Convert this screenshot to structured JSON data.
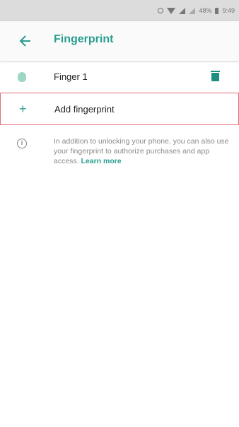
{
  "status_bar": {
    "battery_text": "48%",
    "time": "9:49",
    "icons": [
      "alarm-icon",
      "wifi-icon",
      "signal-icon",
      "signal-icon",
      "battery-icon"
    ]
  },
  "app_bar": {
    "title": "Fingerprint",
    "back_icon": "arrow-left-icon"
  },
  "fingerprints": [
    {
      "label": "Finger 1",
      "icon": "fingerprint-icon",
      "action_icon": "delete-icon"
    }
  ],
  "add": {
    "label": "Add fingerprint",
    "icon": "plus-icon"
  },
  "info": {
    "text": "In addition to unlocking your phone, you can also use your fingerprint to authorize purchases and app access.",
    "link": "Learn more",
    "icon": "info-icon"
  },
  "colors": {
    "accent": "#2a9d8f",
    "highlight_border": "#e0707a",
    "status_bar_bg": "#dcdcdc"
  }
}
